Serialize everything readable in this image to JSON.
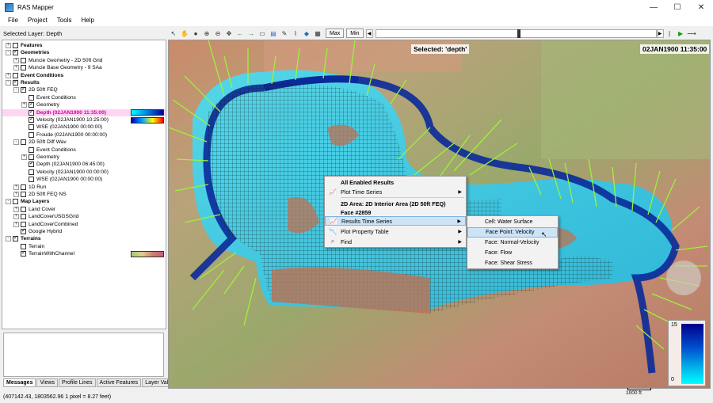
{
  "window": {
    "title": "RAS Mapper",
    "minimize": "—",
    "maximize": "☐",
    "close": "✕"
  },
  "menu": [
    "File",
    "Project",
    "Tools",
    "Help"
  ],
  "selected_layer": "Selected Layer: Depth",
  "toolbar": {
    "max_label": "Max",
    "min_label": "Min"
  },
  "tree": [
    {
      "label": "Features",
      "bold": true,
      "exp": "+",
      "cb": false
    },
    {
      "label": "Geometries",
      "bold": true,
      "exp": "-",
      "cb": true
    },
    {
      "label": "Muncie Geometry - 2D 50ft Grid",
      "exp": "+",
      "cb": false
    },
    {
      "label": "Muncie Base Geometry - 9 SAa",
      "exp": "+",
      "cb": false
    },
    {
      "label": "Event Conditions",
      "bold": true,
      "exp": "+",
      "cb": false
    },
    {
      "label": "Results",
      "bold": true,
      "exp": "-",
      "cb": true
    },
    {
      "label": "2D 50ft FEQ",
      "exp": "-",
      "cb": true
    },
    {
      "label": "Event Conditions",
      "cb": false
    },
    {
      "label": "Geometry",
      "exp": "+",
      "cb": true
    },
    {
      "label": "Depth (02JAN1900 11:35:00)",
      "cb": true,
      "selected": true
    },
    {
      "label": "Velocity (02JAN1900 10:25:00)",
      "cb": true
    },
    {
      "label": "WSE (02JAN1900 00:00:00)",
      "cb": false
    },
    {
      "label": "Froude (02JAN1900 00:00:00)",
      "cb": false
    },
    {
      "label": "2D 50ft Diff Wav",
      "exp": "-",
      "cb": false
    },
    {
      "label": "Event Conditions",
      "cb": false
    },
    {
      "label": "Geometry",
      "exp": "+",
      "cb": false
    },
    {
      "label": "Depth (02JAN1900 06:45:00)",
      "cb": true
    },
    {
      "label": "Velocity (02JAN1900 00:00:00)",
      "cb": false
    },
    {
      "label": "WSE (02JAN1900 00:00:00)",
      "cb": false
    },
    {
      "label": "1D Run",
      "exp": "+",
      "cb": false
    },
    {
      "label": "2D 50ft FEQ NS",
      "exp": "+",
      "cb": false
    },
    {
      "label": "Map Layers",
      "bold": true,
      "exp": "-",
      "cb": false
    },
    {
      "label": "Land Cover",
      "exp": "+",
      "cb": false
    },
    {
      "label": "LandCoverUSGSGrid",
      "exp": "+",
      "cb": false
    },
    {
      "label": "LandCoverCombined",
      "exp": "+",
      "cb": false
    },
    {
      "label": "Google Hybrid",
      "cb": true
    },
    {
      "label": "Terrains",
      "bold": true,
      "exp": "-",
      "cb": true
    },
    {
      "label": "Terrain",
      "cb": false
    },
    {
      "label": "TerrainWithChannel",
      "cb": true
    }
  ],
  "bottom_tabs": [
    "Messages",
    "Views",
    "Profile Lines",
    "Active Features",
    "Layer Values"
  ],
  "status": "(407142.43, 1803562.96  1 pixel = 8.27 feet)",
  "map": {
    "selected_label": "Selected: 'depth'",
    "time_label": "02JAN1900 11:35:00",
    "legend_max": "15",
    "legend_min": "0",
    "scale_label": "1000 ft"
  },
  "context_menu": {
    "header": "All Enabled Results",
    "plot_time_series": "Plot Time Series",
    "area_line": "2D Area: 2D Interior Area  (2D 50ft FEQ)",
    "face_line": "Face #2859",
    "results_time_series": "Results Time Series",
    "plot_property_table": "Plot Property Table",
    "find": "Find"
  },
  "submenu": [
    "Cell: Water Surface",
    "Face Point: Velocity",
    "Face: Normal-Velocity",
    "Face: Flow",
    "Face: Shear Stress"
  ],
  "colors": {
    "accent": "#cde4f7",
    "selected_layer": "#d000a0",
    "depth_deep": "#00008b",
    "depth_shallow": "#00ffff"
  }
}
